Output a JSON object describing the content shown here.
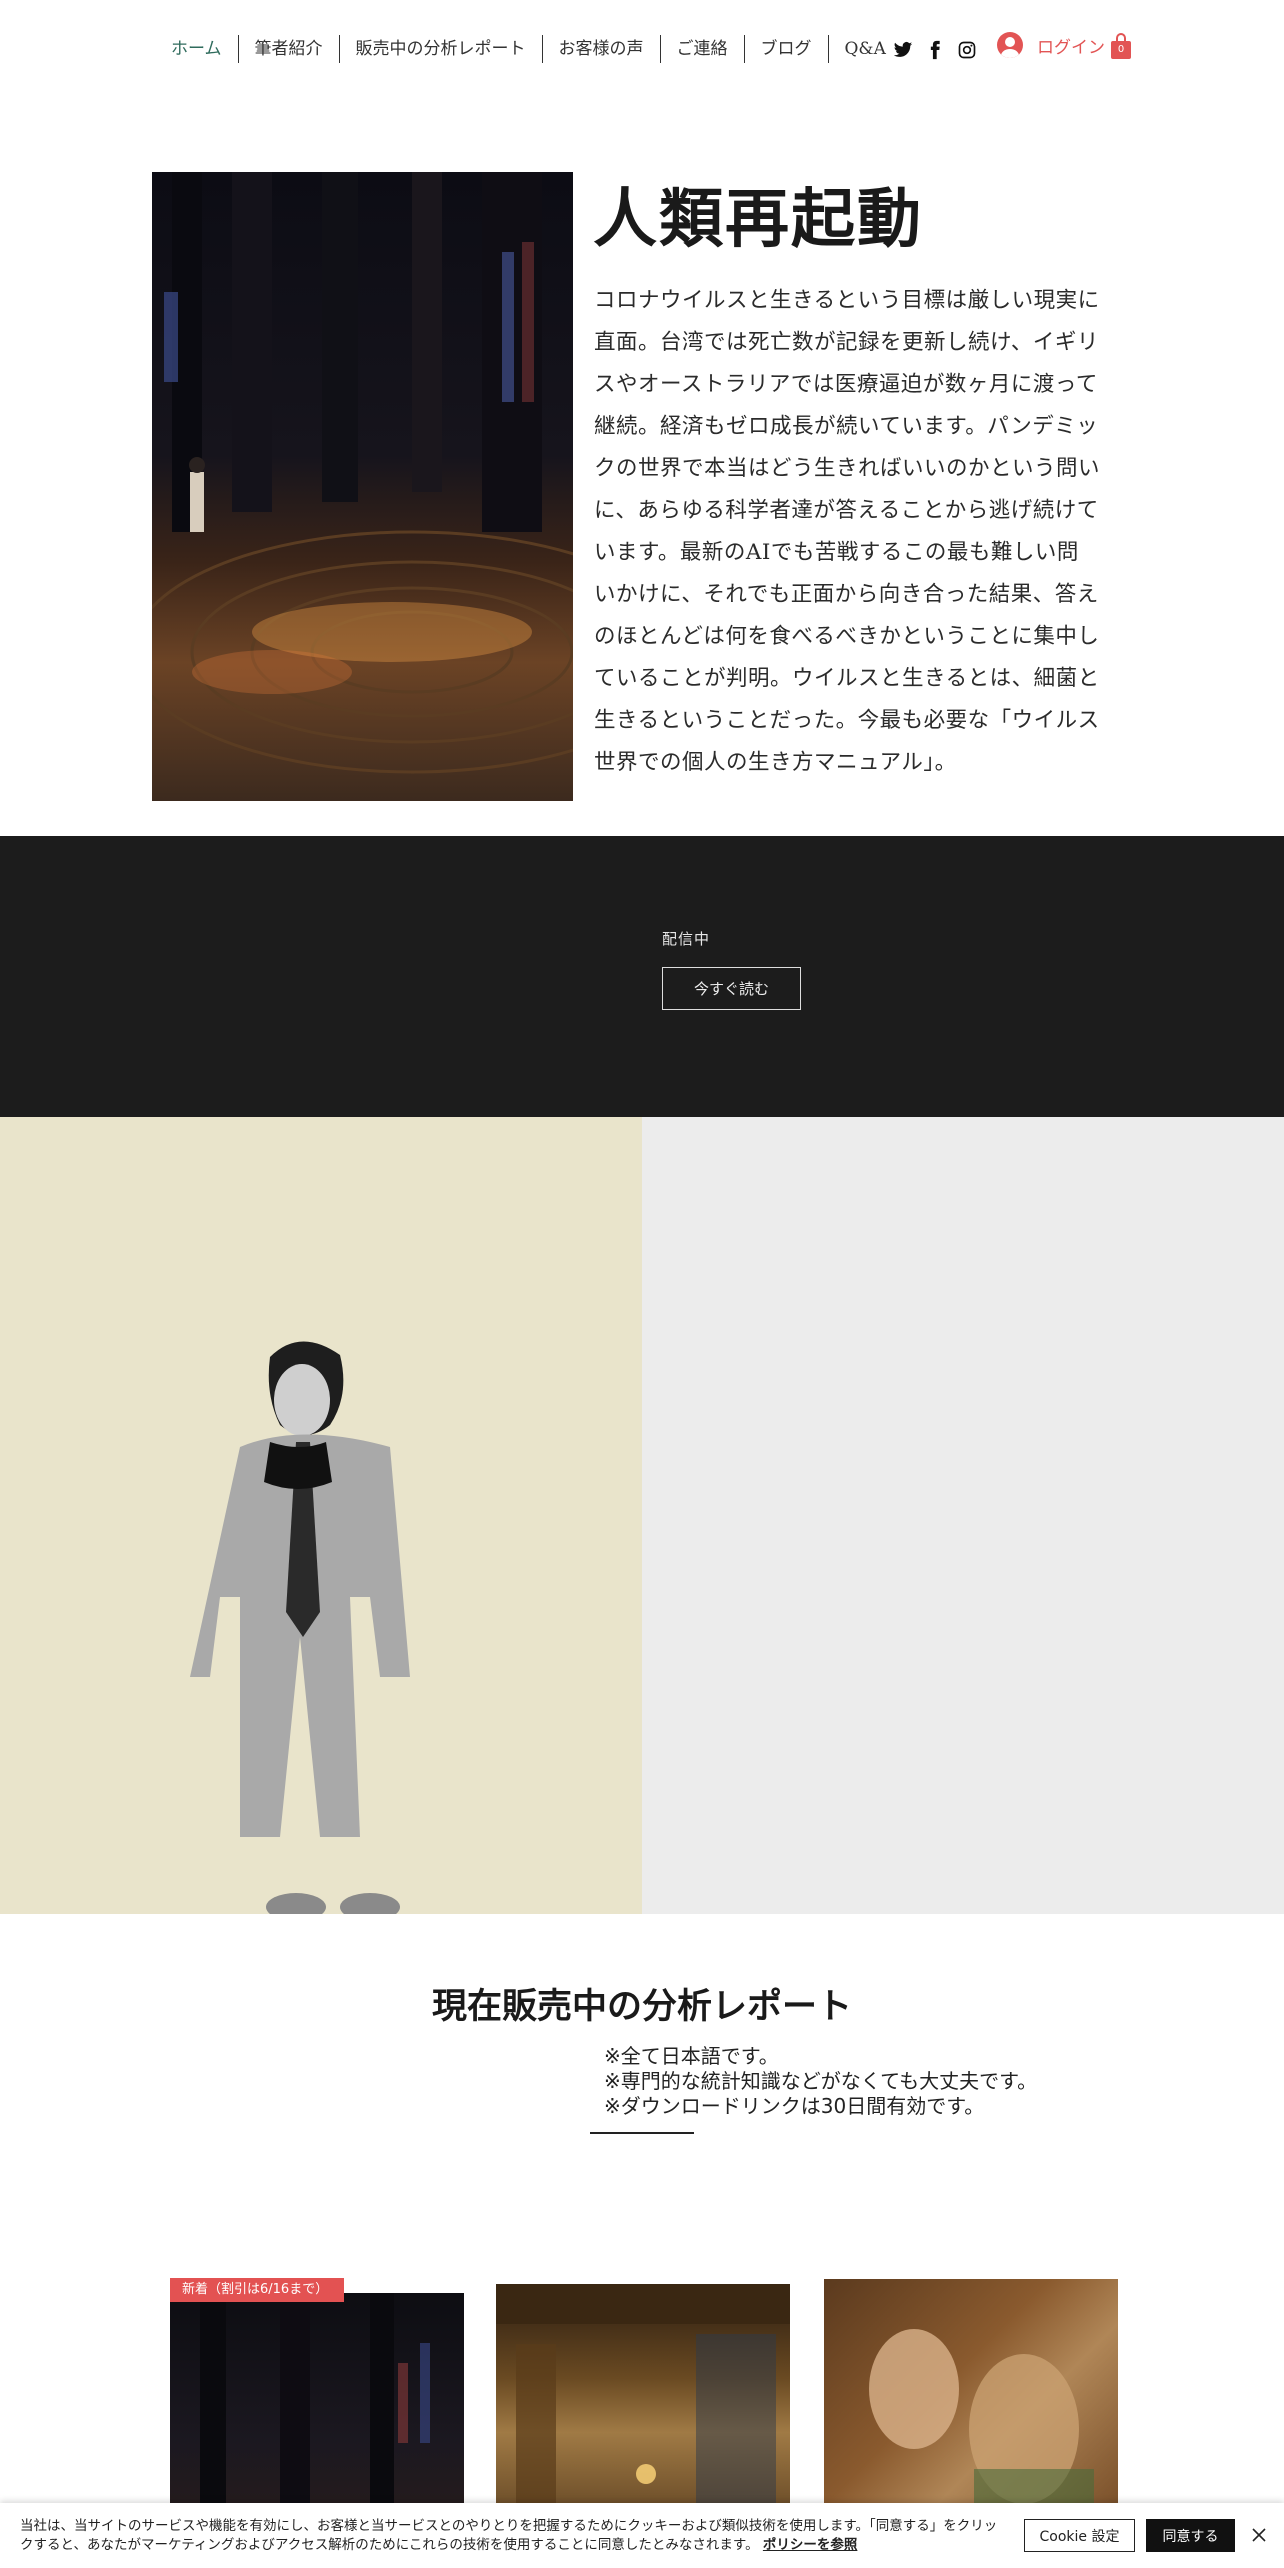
{
  "nav": {
    "items": [
      "ホーム",
      "筆者紹介",
      "販売中の分析レポート",
      "お客様の声",
      "ご連絡",
      "ブログ",
      "Q&A"
    ],
    "social": [
      "twitter-icon",
      "facebook-icon",
      "instagram-icon"
    ],
    "login_label": "ログイン",
    "cart_count": "0"
  },
  "hero": {
    "title": "人類再起動",
    "body": "コロナウイルスと生きるという目標は厳しい現実に直面。台湾では死亡数が記録を更新し続け、イギリスやオーストラリアでは医療逼迫が数ヶ月に渡って継続。経済もゼロ成長が続いています。パンデミックの世界で本当はどう生きればいいのかという問いに、あらゆる科学者達が答えることから逃げ続けています。最新のAIでも苦戦するこの最も難しい問いかけに、それでも正面から向き合った結果、答えのほとんどは何を食べるべきかということに集中していることが判明。ウイルスと生きるとは、細菌と生きるということだった。今最も必要な「ウイルス世界での個人の生き方マニュアル」。"
  },
  "band": {
    "status": "配信中",
    "button": "今すぐ読む"
  },
  "reports": {
    "title": "現在販売中の分析レポート",
    "notes": "※全て日本語です。\n※専門的な統計知識などがなくても大丈夫です。\n※ダウンロードリンクは30日間有効です。",
    "ribbon": "新着（割引は6/16まで）"
  },
  "cookie": {
    "text": "当社は、当サイトのサービスや機能を有効にし、お客様と当サービスとのやりとりを把握するためにクッキーおよび類似技術を使用します。「同意する」をクリックすると、あなたがマーケティングおよびアクセス解析のためにこれらの技術を使用することに同意したとみなされます。",
    "link": "ポリシーを参照",
    "settings": "Cookie 設定",
    "accept": "同意する"
  },
  "colors": {
    "accent": "#e25454",
    "nav_active": "#2f6b5c",
    "band": "#1c1c1c",
    "split_left": "#e9e4cb",
    "split_right": "#ececec"
  }
}
